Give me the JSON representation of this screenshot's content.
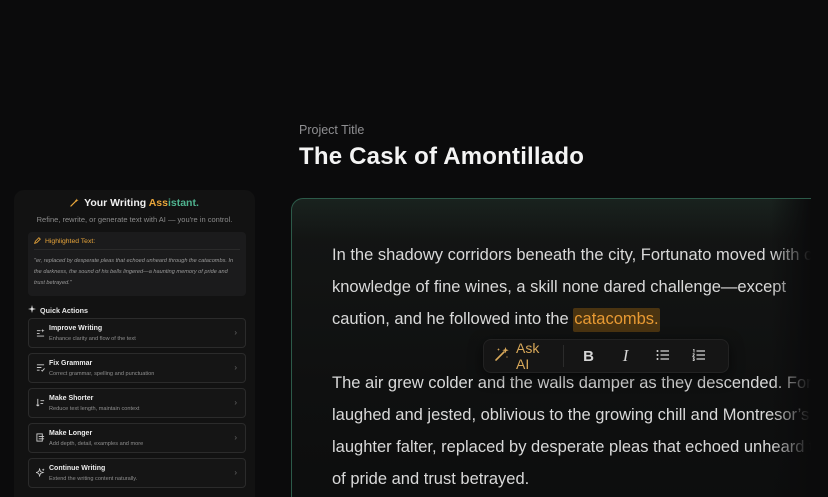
{
  "project": {
    "label": "Project Title",
    "title": "The Cask of Amontillado"
  },
  "editor": {
    "paragraph1": {
      "line1": "In the shadowy corridors beneath the city, Fortunato moved with c",
      "line2": "knowledge of fine wines, a skill none dared challenge—except",
      "line3_before": "caution, and he followed into the ",
      "line3_highlight": "catacombs.",
      "line3_after": ""
    },
    "paragraph2": {
      "line1": " The air grew colder and the walls damper as they descended. For",
      "line2": "laughed and jested, oblivious to the growing chill and Montresor’s",
      "line3": "laughter falter, replaced by desperate pleas that echoed unheard t",
      "line4": "of pride and trust betrayed."
    },
    "highlight_color": "#e89a33"
  },
  "toolbar": {
    "ask_ai_label": "Ask AI",
    "bold_label": "B",
    "italic_label": "I",
    "icons": [
      "magic-wand-icon",
      "bold-icon",
      "italic-icon",
      "bullet-list-icon",
      "numbered-list-icon"
    ]
  },
  "assistant": {
    "title_prefix": "Your Writing ",
    "title_accent_1": "Ass",
    "title_accent_2": "istant.",
    "subtitle": "Refine, rewrite, or generate text with AI — you're in control.",
    "highlighted_label": "Highlighted Text:",
    "highlighted_text": "\"er, replaced by desperate pleas that echoed unheard through the catacombs. In the darkness, the sound of his bells lingered—a haunting memory of pride and trust betrayed.\"",
    "quick_actions_label": "Quick Actions",
    "actions": [
      {
        "name": "Improve Writing",
        "desc": "Enhance clarity and flow of the text",
        "icon": "text-improve-icon"
      },
      {
        "name": "Fix Grammar",
        "desc": "Correct grammar, spelling and punctuation",
        "icon": "grammar-check-icon"
      },
      {
        "name": "Make Shorter",
        "desc": "Reduce text length, maintain context",
        "icon": "shorten-icon"
      },
      {
        "name": "Make Longer",
        "desc": "Add depth, detail, examples and more",
        "icon": "lengthen-icon"
      },
      {
        "name": "Continue Writing",
        "desc": "Extend the writing content naturally.",
        "icon": "sparkle-icon"
      }
    ],
    "accent_orange": "#e8a53a",
    "accent_green": "#4fb38f"
  }
}
